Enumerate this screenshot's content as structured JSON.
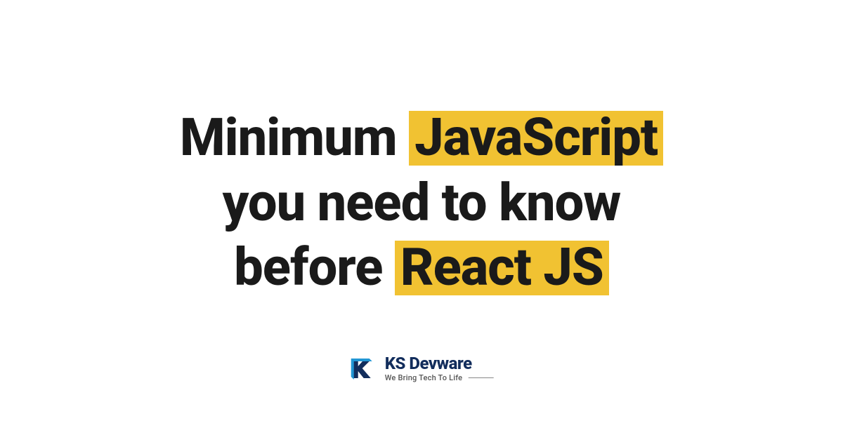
{
  "title": {
    "line1_part1": "Minimum",
    "line1_highlight": "JavaScript",
    "line2": "you need to know",
    "line3_part1": "before",
    "line3_highlight": "React JS"
  },
  "logo": {
    "name": "KS Devware",
    "tagline": "We Bring Tech To Life"
  },
  "colors": {
    "highlight": "#f1c232",
    "text": "#1a1a1a",
    "logo_primary": "#122d5c",
    "logo_accent": "#2196d4"
  }
}
